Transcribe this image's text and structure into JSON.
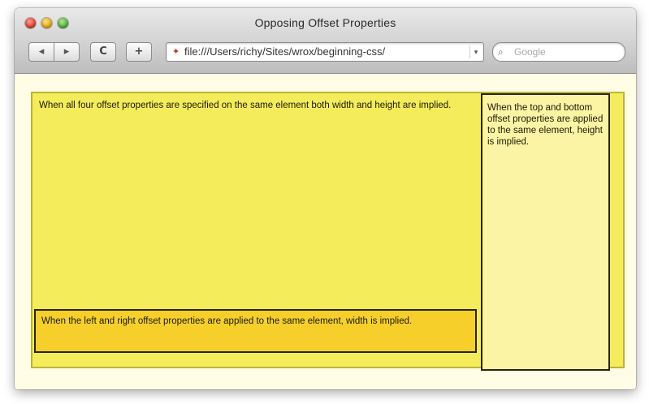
{
  "window": {
    "title": "Opposing Offset Properties"
  },
  "toolbar": {
    "back_label": "◂",
    "forward_label": "▸",
    "reload_label": "C",
    "add_label": "+",
    "url": "file:///Users/richy/Sites/wrox/beginning-css/",
    "search_placeholder": "Google"
  },
  "content": {
    "all_four_text": "When all four offset properties are specified on the same element both width and height are implied.",
    "top_bottom_text": "When the top and bottom offset properties are applied to the same element, height is implied.",
    "left_right_text": "When the left and right offset properties are applied to the same element, width is implied."
  },
  "colors": {
    "container": "#f4ec5a",
    "top_bottom_box": "#fbf4a4",
    "left_right_box": "#f6cf2a",
    "border": "#2a2410"
  }
}
